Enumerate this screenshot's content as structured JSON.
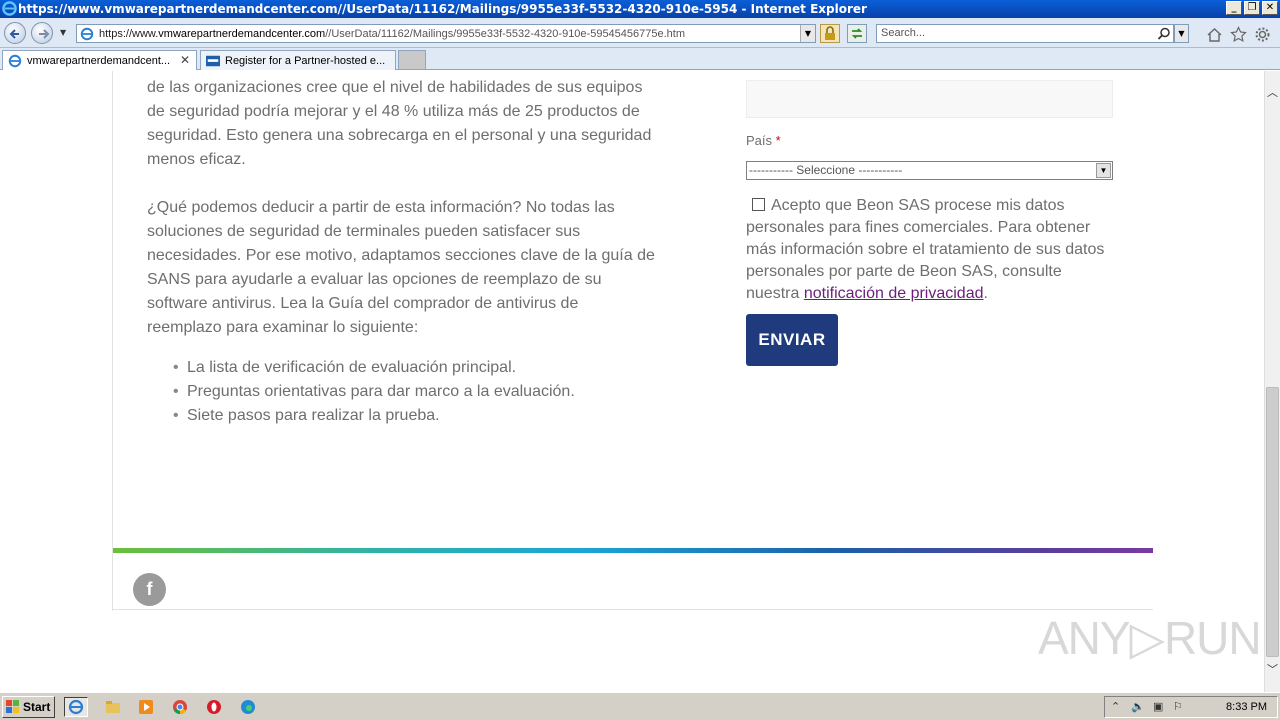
{
  "window": {
    "title": "https://www.vmwarepartnerdemandcenter.com//UserData/11162/Mailings/9955e33f-5532-4320-910e-5954 - Internet Explorer",
    "minimize": "_",
    "restore": "❐",
    "close": "✕"
  },
  "address_bar": {
    "url_prefix": "https://www.",
    "url_host": "vmwarepartnerdemandcenter.com",
    "url_path": "//UserData/11162/Mailings/9955e33f-5532-4320-910e-59545456775e.htm"
  },
  "search": {
    "placeholder": "Search..."
  },
  "tabs": [
    {
      "label": "vmwarepartnerdemandcent...",
      "active": true,
      "close": "✕"
    },
    {
      "label": "Register for a Partner-hosted e...",
      "active": false
    }
  ],
  "content": {
    "para1": "de las organizaciones cree que el nivel de habilidades de sus equipos de seguridad podría mejorar y el 48 % utiliza más de 25 productos de seguridad. Esto genera una sobrecarga en el personal y una seguridad menos eficaz.",
    "para2": "¿Qué podemos deducir a partir de esta información? No todas las soluciones de seguridad de terminales pueden satisfacer sus necesidades. Por ese motivo, adaptamos secciones clave de la guía de SANS para ayudarle a evaluar las opciones de reemplazo de su software antivirus. Lea la Guía del comprador de antivirus de reemplazo para examinar lo siguiente:",
    "bullets": [
      "La lista de verificación de evaluación principal.",
      "Preguntas orientativas para dar marco a la evaluación.",
      "Siete pasos para realizar la prueba."
    ]
  },
  "form": {
    "country_label": "País",
    "required_mark": "*",
    "country_select_value": "----------- Seleccione -----------",
    "consent_text": "Acepto que Beon SAS procese mis datos personales para fines comerciales. Para obtener más información sobre el tratamiento de sus datos personales por parte de Beon SAS, consulte nuestra",
    "privacy_link": "notificación de privacidad",
    "period": ".",
    "submit_label": "ENVIAR"
  },
  "footer": {
    "facebook_glyph": "f"
  },
  "watermark": "ANY▷RUN",
  "taskbar": {
    "start_label": "Start",
    "clock": "8:33 PM"
  },
  "colors": {
    "title_bar": "#0841a8",
    "submit_button": "#1f3a7d",
    "link": "#6b1f7a",
    "body_text": "#6e6e6e",
    "required": "#cc0000"
  }
}
